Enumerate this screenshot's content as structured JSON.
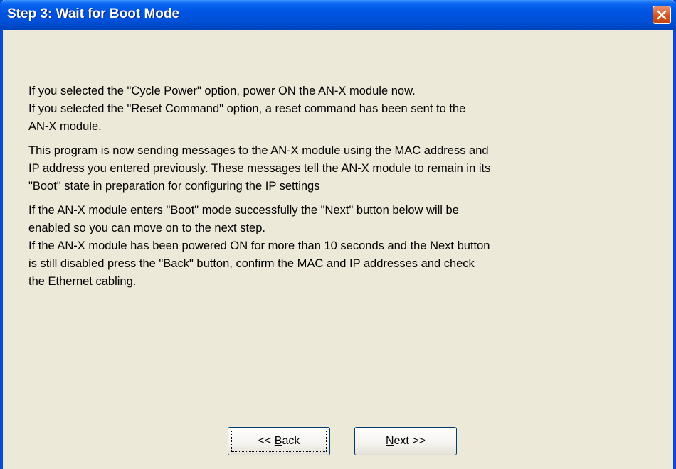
{
  "window": {
    "title": "Step 3: Wait for Boot Mode",
    "close_icon": "close-icon"
  },
  "content": {
    "para1": {
      "lines": [
        "If you selected the \"Cycle Power\" option, power ON the AN-X module now.",
        "If you selected the \"Reset Command\" option, a reset command has been sent to the",
        "AN-X module."
      ]
    },
    "para2": {
      "lines": [
        "This program is now sending messages to the AN-X module using the MAC address and",
        "IP address you entered previously. These messages tell the AN-X module to remain in its",
        "\"Boot\" state in preparation for configuring the IP settings"
      ]
    },
    "para3": {
      "lines": [
        "If the AN-X module enters \"Boot\" mode successfully the \"Next\" button below will be",
        "enabled so you can move on to the next step.",
        "If the AN-X module has been powered ON for more than 10 seconds and the Next button",
        "is still disabled press the \"Back\" button, confirm the MAC and IP addresses and check",
        "the Ethernet cabling."
      ]
    }
  },
  "buttons": {
    "back": {
      "prefix": "<< ",
      "accel": "B",
      "rest": "ack"
    },
    "next": {
      "accel": "N",
      "rest": "ext >>"
    }
  }
}
